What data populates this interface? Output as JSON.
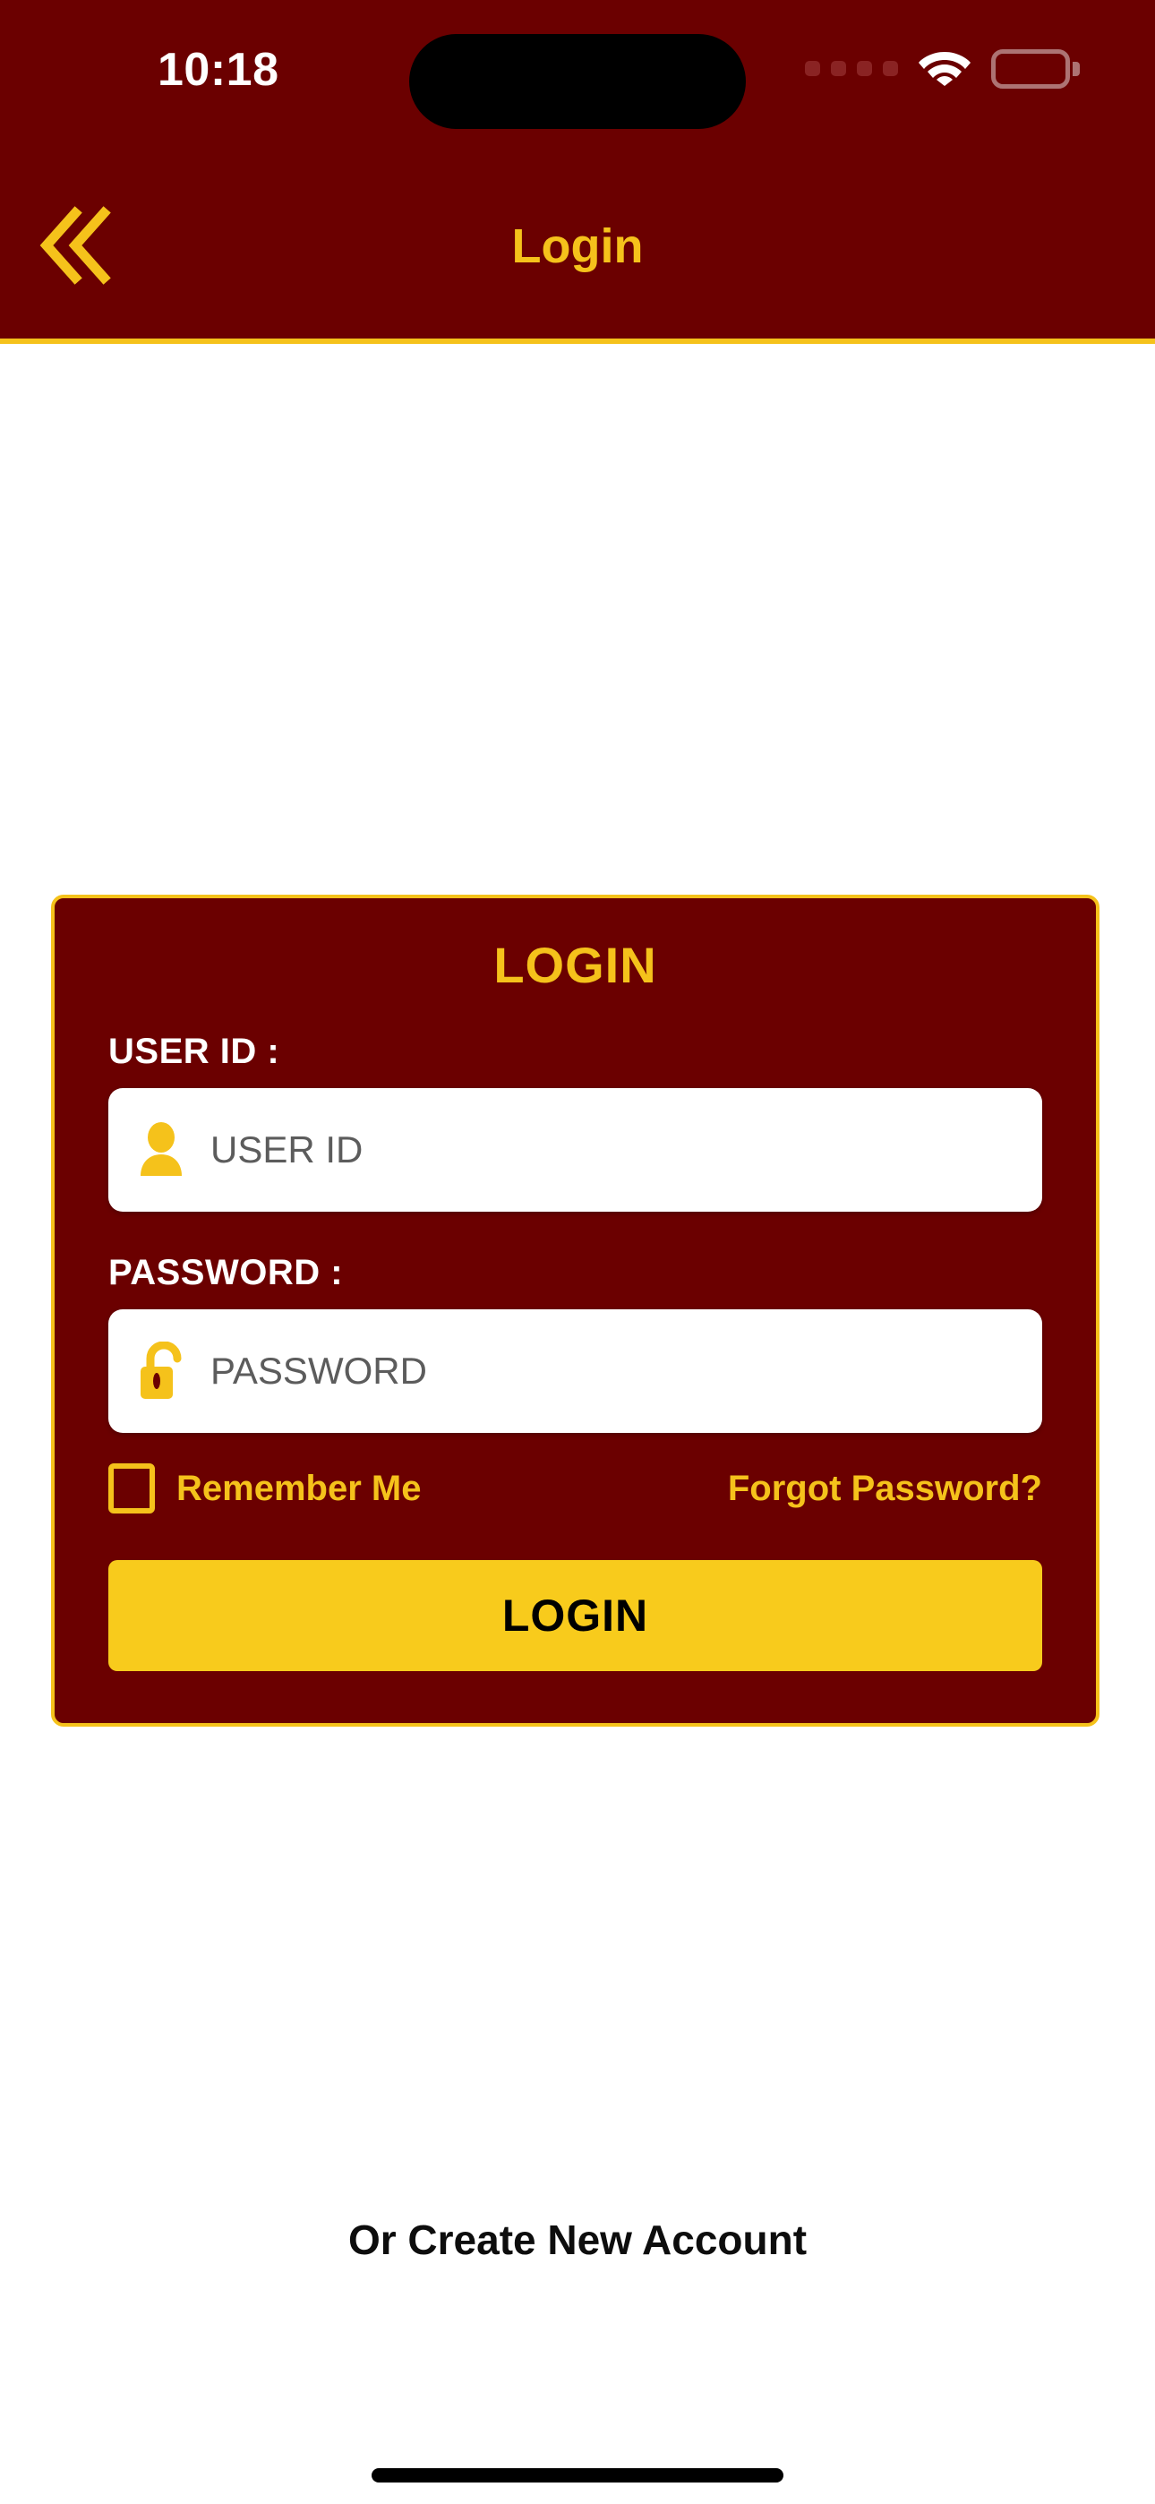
{
  "status_bar": {
    "time": "10:18",
    "cellular_icon": "cellular-dots-icon",
    "wifi_icon": "wifi-icon",
    "battery_icon": "battery-icon",
    "dynamic_island": "dynamic-island"
  },
  "header": {
    "back_icon": "double-chevron-left-icon",
    "title": "Login",
    "background_color": "#6B0000",
    "accent_color": "#F5C21B"
  },
  "login_card": {
    "title": "LOGIN",
    "user_id": {
      "label": "USER ID :",
      "placeholder": "USER ID",
      "value": "",
      "icon": "user-icon"
    },
    "password": {
      "label": "PASSWORD :",
      "placeholder": "PASSWORD",
      "value": "",
      "icon": "unlock-padlock-icon"
    },
    "remember_me": {
      "label": "Remember Me",
      "checked": false
    },
    "forgot_password": "Forgot Password?",
    "submit_label": "LOGIN",
    "background_color": "#6B0000",
    "border_color": "#F5C21B",
    "button_color": "#F8CB1C"
  },
  "footer": {
    "create_account": "Or Create New Account"
  }
}
